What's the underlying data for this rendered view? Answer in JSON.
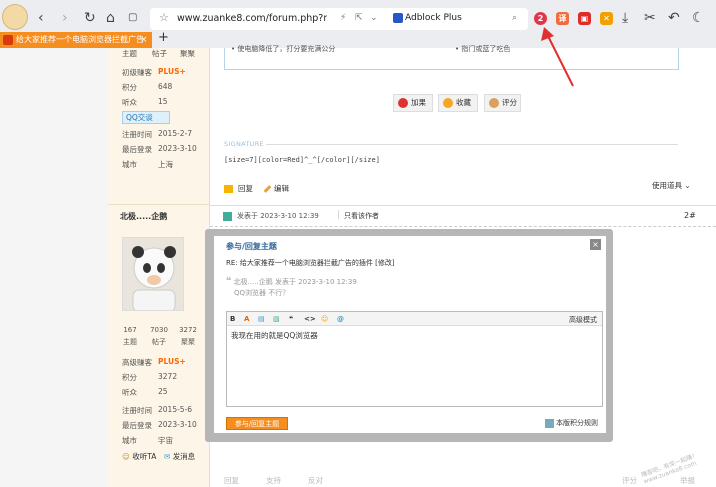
{
  "browser": {
    "url": "www.zuanke8.com/forum.php?moc",
    "adblock_label": "Adblock Plus",
    "tab_title": "给大家推荐一个电脑浏览器拦截广告",
    "ext_badge": "2"
  },
  "user1": {
    "top_labels": [
      "主题",
      "帖子",
      "聚聚"
    ],
    "rank_label": "初级赚客",
    "rank_badge": "PLUS+",
    "points_label": "积分",
    "points": "648",
    "coins_label": "听众",
    "coins": "15",
    "qq_label": "QQ交谈",
    "reg_label": "注册时间",
    "reg": "2015-2-7",
    "last_label": "最后登录",
    "last": "2023-3-10",
    "city_label": "城市",
    "city": "上海"
  },
  "user2": {
    "name": "北极.....企鹅",
    "stats": [
      {
        "n": "167",
        "l": "主题"
      },
      {
        "n": "7030",
        "l": "帖子"
      },
      {
        "n": "3272",
        "l": "聚聚"
      }
    ],
    "rank_label": "高级赚客",
    "rank_badge": "PLUS+",
    "points_label": "积分",
    "points": "3272",
    "coins_label": "听众",
    "coins": "25",
    "reg_label": "注册时间",
    "reg": "2015-5-6",
    "last_label": "最后登录",
    "last": "2023-3-10",
    "city_label": "城市",
    "city": "宇宙",
    "follow_label": "收听TA",
    "message_label": "发消息"
  },
  "post": {
    "box_left": "• 使电脑降低了，打分要充满公分",
    "box_right": "• 指门或蓝了吃色",
    "buttons": [
      "加果",
      "收藏",
      "评分"
    ],
    "signature_label": "SIGNATURE",
    "signature_text": "[size=7][color=Red]^_^[/color][/size]",
    "reply_label": "回复",
    "edit_label": "编辑",
    "tools_label": "使用道具",
    "posted_at": "发表于 2023-3-10 12:39",
    "only_author": "只看该作者",
    "floor": "2#"
  },
  "modal": {
    "title": "参与/回复主题",
    "close": "×",
    "re_line": "RE: 给大家推荐一个电脑浏览器拦截广告的插件 [修改]",
    "quote_line1": "北极.....企鹅 发表于 2023-3-10 12:39",
    "quote_line2": "QQ浏览器 不行？",
    "editor_tools": [
      "B",
      "A",
      "▤",
      "▧",
      "❝",
      "<>",
      "☺",
      "@"
    ],
    "advanced": "高级模式",
    "content": "我现在用的就是QQ浏览器",
    "submit": "参与/回复主题",
    "rules": "本版积分规则"
  },
  "footer_ghost": [
    "回复",
    "支持",
    "反对"
  ],
  "ghost_right": [
    "评分",
    "举报"
  ],
  "watermark": "赚客吧，有奖一起赚！ www.zuanke8.com"
}
